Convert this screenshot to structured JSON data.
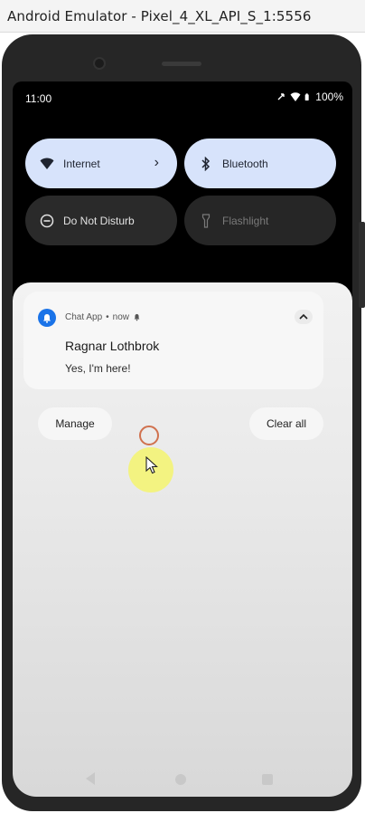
{
  "window": {
    "title": "Android Emulator - Pixel_4_XL_API_S_1:5556"
  },
  "status_bar": {
    "time": "11:00",
    "battery": "100%"
  },
  "quick_settings": {
    "tiles": [
      {
        "label": "Internet",
        "icon": "wifi-icon",
        "state": "on"
      },
      {
        "label": "Bluetooth",
        "icon": "bluetooth-icon",
        "state": "on"
      },
      {
        "label": "Do Not Disturb",
        "icon": "do-not-disturb-icon",
        "state": "off"
      },
      {
        "label": "Flashlight",
        "icon": "flashlight-icon",
        "state": "unavailable"
      }
    ]
  },
  "notification": {
    "app_name": "Chat App",
    "time": "now",
    "title": "Ragnar Lothbrok",
    "body": "Yes, I'm here!"
  },
  "actions": {
    "manage": "Manage",
    "clear_all": "Clear all"
  },
  "colors": {
    "accent": "#1a73e8",
    "tile_on": "#d7e3fb",
    "touch_indicator": "#f5f56e"
  }
}
